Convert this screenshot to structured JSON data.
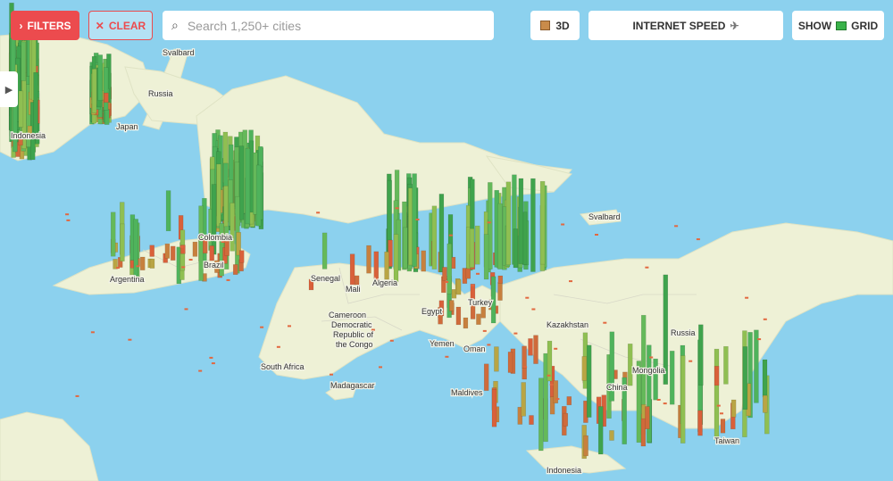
{
  "toolbar": {
    "filters_label": "FILTERS",
    "clear_label": "CLEAR",
    "search_placeholder": "Search 1,250+ cities",
    "view_3d_label": "3D",
    "internet_speed_label": "INTERNET SPEED",
    "show_label": "SHOW",
    "grid_label": "GRID"
  },
  "colors": {
    "accent": "#ec4b4e",
    "water": "#8cd1ee",
    "land": "#eef1d6"
  },
  "map_labels": {
    "svalbard_top": "Svalbard",
    "russia_top": "Russia",
    "japan": "Japan",
    "indonesia_left": "Indonesia",
    "colombia": "Colombia",
    "brazil": "Brazil",
    "argentina": "Argentina",
    "senegal": "Senegal",
    "mali": "Mali",
    "algeria": "Algeria",
    "egypt": "Egypt",
    "turkey": "Turkey",
    "cameroon": "Cameroon",
    "drc_1": "Democratic",
    "drc_2": "Republic of",
    "drc_3": "the Congo",
    "yemen": "Yemen",
    "oman": "Oman",
    "south_africa": "South Africa",
    "madagascar": "Madagascar",
    "maldives": "Maldives",
    "kazakhstan": "Kazakhstan",
    "svalbard_right": "Svalbard",
    "russia_right": "Russia",
    "mongolia": "Mongolia",
    "china": "China",
    "taiwan": "Taiwan",
    "indonesia_bottom": "Indonesia"
  }
}
